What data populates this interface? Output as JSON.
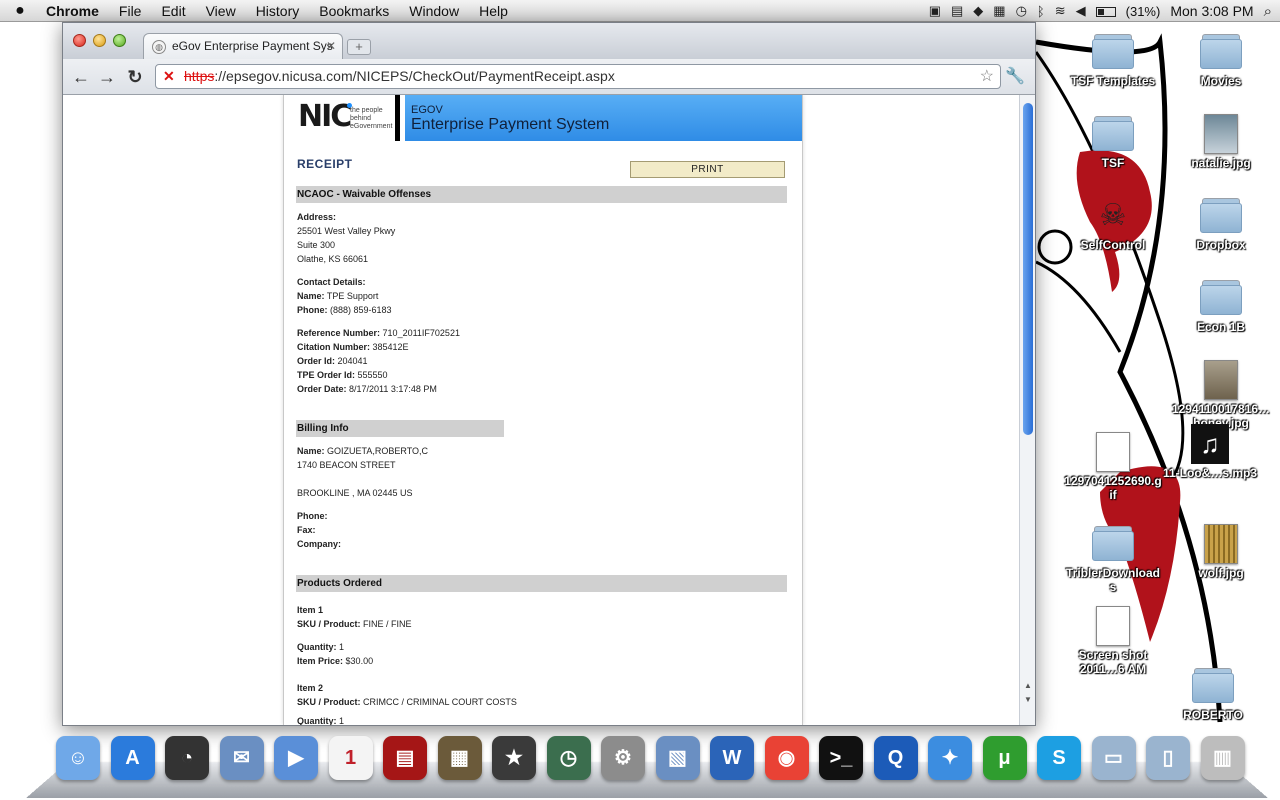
{
  "menubar": {
    "apple": "",
    "app_name": "Chrome",
    "menus": [
      "File",
      "Edit",
      "View",
      "History",
      "Bookmarks",
      "Window",
      "Help"
    ],
    "battery": "(31%)",
    "clock": "Mon 3:08 PM"
  },
  "browser": {
    "tab_title": "eGov Enterprise Payment Sys",
    "url_scheme": "https",
    "url_rest": "://epsegov.nicusa.com/NICEPS/CheckOut/PaymentReceipt.aspx"
  },
  "header": {
    "logo_text": "NIC",
    "logo_tagline": [
      "the people",
      "behind",
      "eGovernment"
    ],
    "banner_small": "EGOV",
    "banner_large": "Enterprise Payment System"
  },
  "receipt": {
    "title": "RECEIPT",
    "print_label": "PRINT",
    "merchant": "NCAOC - Waivable Offenses",
    "address_label": "Address:",
    "address_lines": [
      "25501 West Valley Pkwy",
      "Suite 300",
      "Olathe, KS 66061"
    ],
    "contact_label": "Contact Details:",
    "contact_name_label": "Name:",
    "contact_name": "TPE Support",
    "contact_phone_label": "Phone:",
    "contact_phone": "(888) 859-6183",
    "reference_label": "Reference Number:",
    "reference": "710_2011IF702521",
    "citation_label": "Citation Number:",
    "citation": "385412E",
    "order_id_label": "Order Id:",
    "order_id": "204041",
    "tpe_order_label": "TPE Order Id:",
    "tpe_order": "555550",
    "order_date_label": "Order Date:",
    "order_date": "8/17/2011 3:17:48 PM"
  },
  "billing": {
    "heading": "Billing Info",
    "name_label": "Name:",
    "name": "GOIZUETA,ROBERTO,C",
    "street": "1740 BEACON STREET",
    "city_line": "BROOKLINE , MA 02445 US",
    "phone_label": "Phone:",
    "fax_label": "Fax:",
    "company_label": "Company:"
  },
  "products": {
    "heading": "Products Ordered",
    "items": [
      {
        "title": "Item 1",
        "sku_label": "SKU / Product:",
        "sku": "FINE / FINE",
        "qty_label": "Quantity:",
        "qty": "1",
        "price_label": "Item Price:",
        "price": "$30.00"
      },
      {
        "title": "Item 2",
        "sku_label": "SKU / Product:",
        "sku": "CRIMCC / CRIMINAL COURT COSTS",
        "qty_label": "Quantity:",
        "qty": "1"
      }
    ]
  },
  "desktop_icons": [
    "TSF Templates",
    "TSF",
    "SelfControl",
    "Movies",
    "natalie.jpg",
    "Dropbox",
    "Econ 1B",
    "1294110017816…honey.jpg",
    "1297041252690.gif",
    "11-Loo&…s.mp3",
    "TriblerDownloads",
    "wolf.jpg",
    "Screen shot 2011…6 AM",
    "ROBERTO"
  ],
  "dock": [
    "Finder",
    "App Store",
    "Dashboard",
    "Mail",
    "FaceTime",
    "iCal",
    "Photo Booth",
    "iPhoto",
    "iMovie",
    "Time Machine",
    "System Preferences",
    "Preview",
    "Word",
    "Chrome",
    "Terminal",
    "QuickTime",
    "Safari",
    "uTorrent",
    "Skype",
    "Applications",
    "Documents",
    "Trash"
  ],
  "colors": {
    "banner": "#3d9af0",
    "section_bar": "#d0d0d0",
    "print_button": "#f2ebc8",
    "receipt_title": "#2a3f6a",
    "ssl_error": "#dd1111"
  }
}
